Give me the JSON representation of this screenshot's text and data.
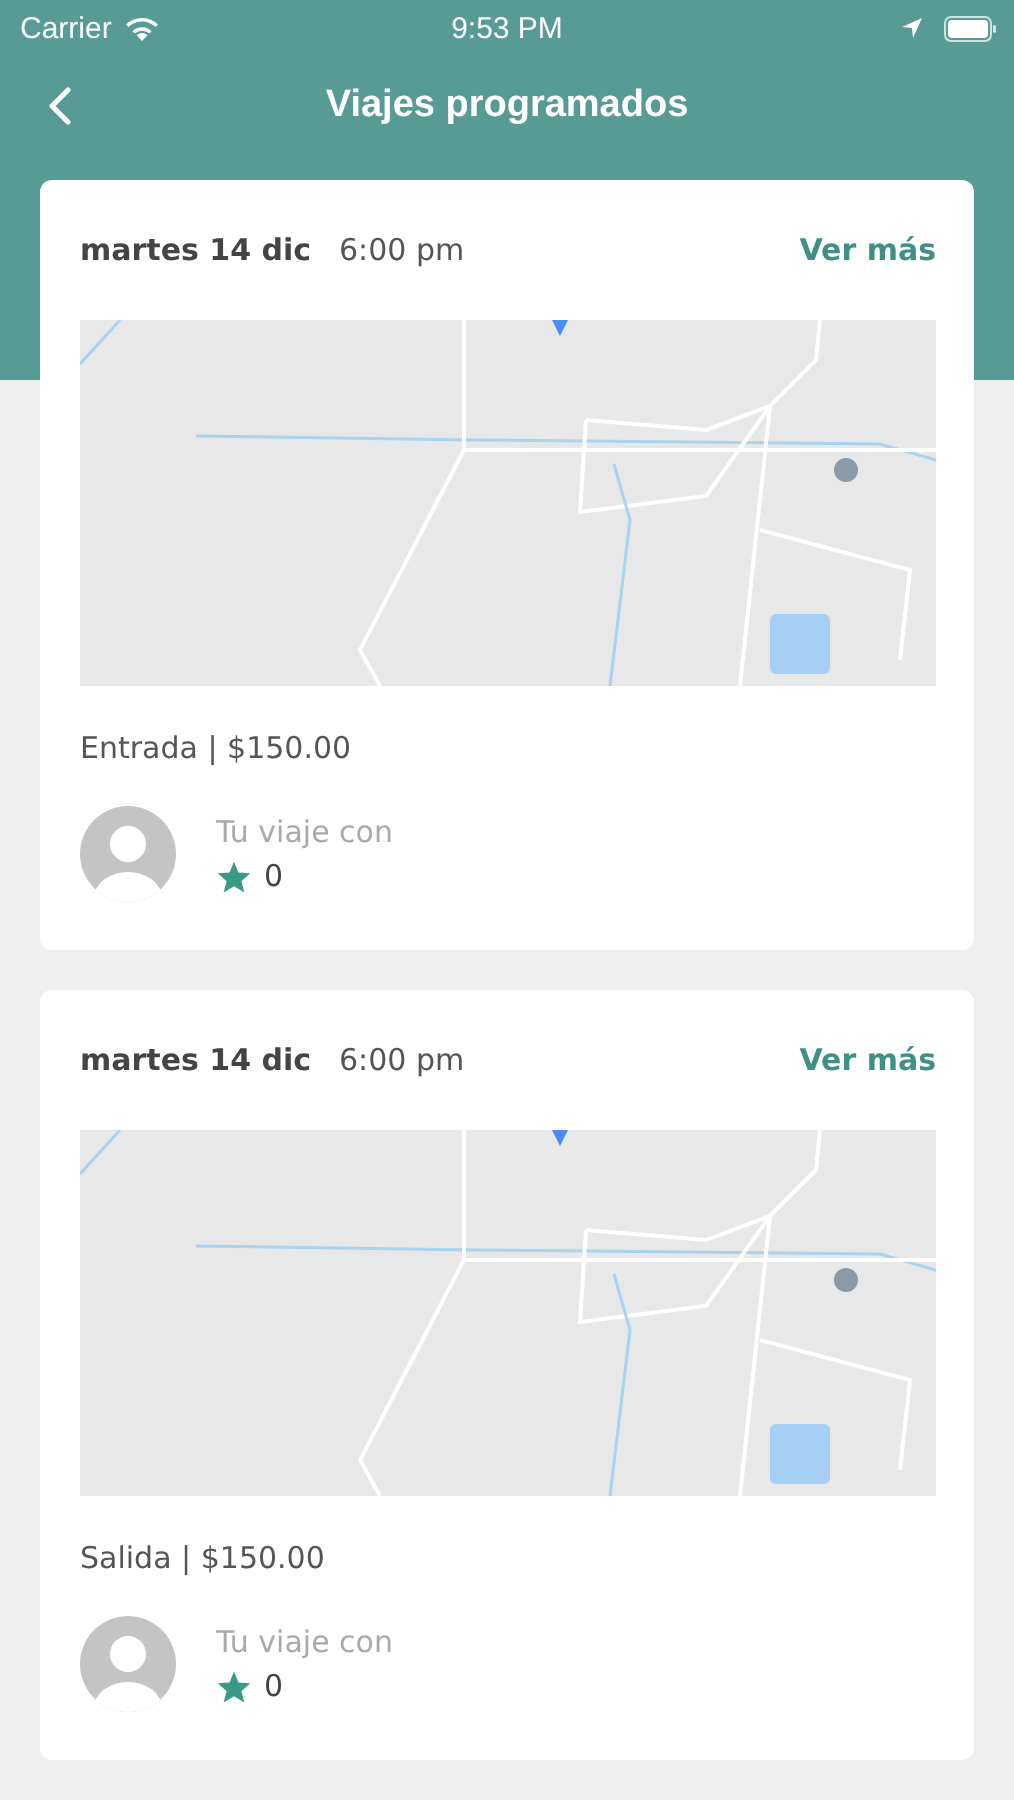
{
  "status_bar": {
    "carrier": "Carrier",
    "time": "9:53 PM"
  },
  "nav": {
    "title": "Viajes programados"
  },
  "trips": [
    {
      "date": "martes 14 dic",
      "time": "6:00 pm",
      "action": "Ver más",
      "summary": "Entrada | $150.00",
      "driver_label": "Tu viaje con",
      "rating": "0"
    },
    {
      "date": "martes 14 dic",
      "time": "6:00 pm",
      "action": "Ver más",
      "summary": "Salida | $150.00",
      "driver_label": "Tu viaje con",
      "rating": "0"
    }
  ]
}
